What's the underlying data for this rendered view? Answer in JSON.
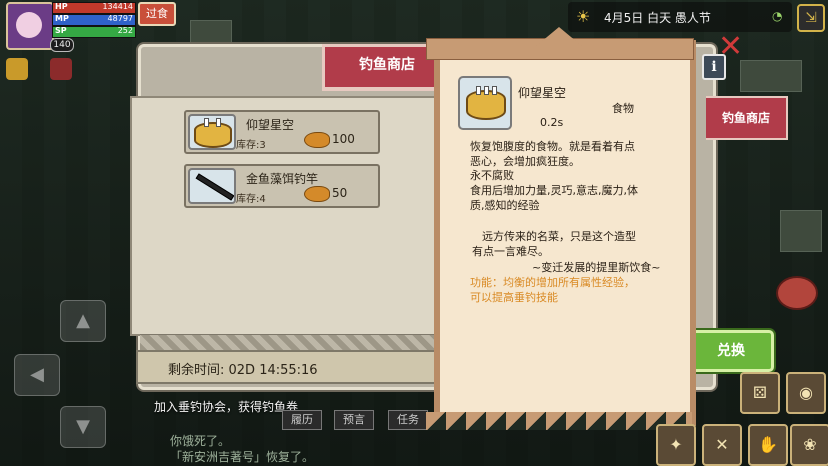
{
  "hud": {
    "hp_label": "HP",
    "hp_value": "134414",
    "mp_label": "MP",
    "mp_value": "48797",
    "sp_label": "SP",
    "sp_value": "252",
    "level": "140",
    "hud_button": "过食",
    "date": "4月5日  白天  愚人节"
  },
  "shop": {
    "title": "钓鱼商店",
    "tab_label": "钓鱼商店",
    "items": [
      {
        "name": "仰望星空",
        "stock": "库存:3",
        "price": "100"
      },
      {
        "name": "金鱼藻饵钓竿",
        "stock": "库存:4",
        "price": "50"
      }
    ],
    "timer": "剩余时间: 02D 14:55:16",
    "exchange_button": "兑换",
    "quest": "加入垂钓协会，获得钓鱼券",
    "tabs": [
      "履历",
      "预言",
      "任务"
    ]
  },
  "tooltip": {
    "title": "仰望星空",
    "type": "食物",
    "time": "0.2s",
    "desc": [
      "恢复饱腹度的食物。就是看着有点",
      "恶心，会增加疯狂度。",
      "永不腐败",
      "食用后增加力量,灵巧,意志,魔力,体",
      "质,感知的经验"
    ],
    "quote": [
      "远方传来的名菜，只是这个造型",
      "有点一言难尽。"
    ],
    "quote_source": "~变迁发展的提里斯饮食~",
    "function": [
      "功能：均衡的增加所有属性经验，",
      "可以提高垂钓技能"
    ]
  },
  "chat": [
    "你饿死了。",
    "「新安洲吉著号」恢复了。"
  ],
  "colors": {
    "accent_red": "#b13c4a",
    "exchange_green": "#6bb63b",
    "function_orange": "#d98a24",
    "hp_fill": "#c0392b",
    "mp_fill": "#2f62c9",
    "sp_fill": "#35a844"
  }
}
